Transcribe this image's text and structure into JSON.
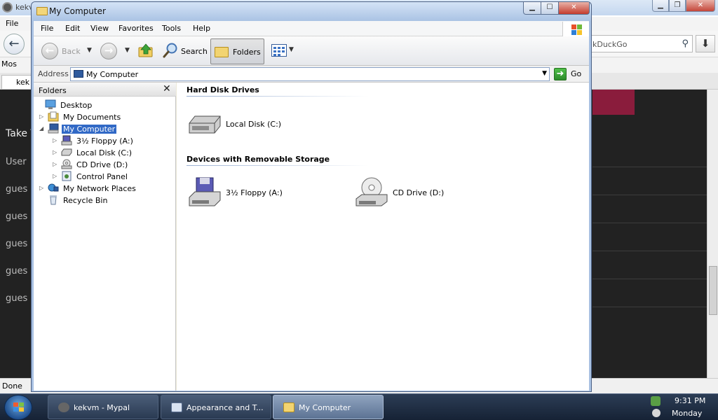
{
  "background_browser": {
    "title": "kekv",
    "menu_file": "File",
    "search_text": "kDuckGo",
    "bookmark_label": "Mos",
    "tab_label": "kek",
    "side_items": [
      "Take T",
      "User",
      "gues",
      "gues",
      "gues",
      "gues",
      "gues"
    ],
    "status": "Done",
    "minimize_glyph": "▁",
    "maximize_glyph": "❐",
    "close_glyph": "✕"
  },
  "window": {
    "title": "My Computer",
    "minimize_glyph": "▁",
    "maximize_glyph": "☐",
    "close_glyph": "✕"
  },
  "menubar": {
    "items": [
      "File",
      "Edit",
      "View",
      "Favorites",
      "Tools",
      "Help"
    ]
  },
  "toolbar": {
    "back_label": "Back",
    "search_label": "Search",
    "folders_label": "Folders"
  },
  "address": {
    "label": "Address",
    "value": "My Computer",
    "go_label": "Go"
  },
  "folders_pane": {
    "title": "Folders",
    "close_glyph": "✕",
    "tree": [
      {
        "label": "Desktop",
        "icon": "desktop-icon",
        "expander": ""
      },
      {
        "label": "My Documents",
        "icon": "my-documents-icon",
        "expander": "▷"
      },
      {
        "label": "My Computer",
        "icon": "my-computer-icon",
        "expander": "◢",
        "selected": true
      },
      {
        "label": "3½ Floppy (A:)",
        "icon": "floppy-drive-icon",
        "expander": "▷"
      },
      {
        "label": "Local Disk (C:)",
        "icon": "hard-disk-icon",
        "expander": "▷"
      },
      {
        "label": "CD Drive (D:)",
        "icon": "cd-drive-icon",
        "expander": "▷"
      },
      {
        "label": "Control Panel",
        "icon": "control-panel-icon",
        "expander": "▷"
      },
      {
        "label": "My Network Places",
        "icon": "network-places-icon",
        "expander": "▷"
      },
      {
        "label": "Recycle Bin",
        "icon": "recycle-bin-icon",
        "expander": ""
      }
    ]
  },
  "content": {
    "groups": [
      {
        "heading": "Hard Disk Drives",
        "items": [
          {
            "label": "Local Disk (C:)",
            "icon": "hard-disk-icon"
          }
        ]
      },
      {
        "heading": "Devices with Removable Storage",
        "items": [
          {
            "label": "3½ Floppy (A:)",
            "icon": "floppy-drive-icon"
          },
          {
            "label": "CD Drive (D:)",
            "icon": "cd-drive-icon"
          }
        ]
      }
    ]
  },
  "taskbar": {
    "tasks": [
      {
        "label": "kekvm - Mypal",
        "icon": "mypal-icon",
        "active": false
      },
      {
        "label": "Appearance and T...",
        "icon": "control-panel-icon",
        "active": false
      },
      {
        "label": "My Computer",
        "icon": "folder-icon",
        "active": true
      }
    ],
    "clock_time": "9:31 PM",
    "clock_day": "Monday"
  },
  "colors": {
    "selection": "#3169c6",
    "title_gradient_top": "#d4e3f6",
    "taskbar": "#1f2d42"
  }
}
